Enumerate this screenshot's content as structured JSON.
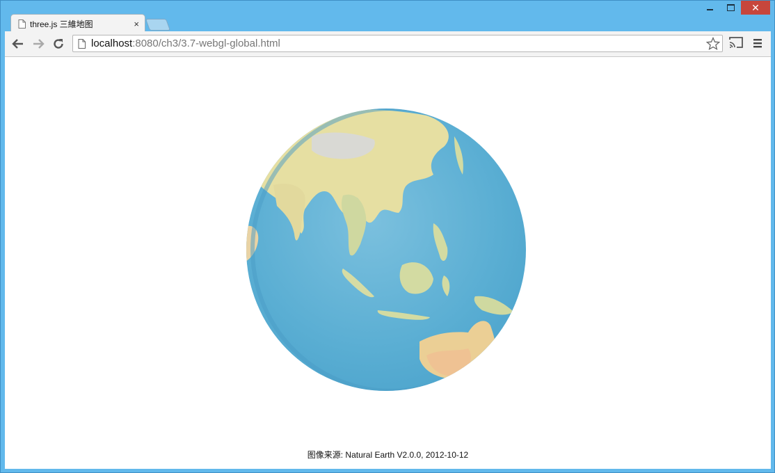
{
  "window": {
    "caption_buttons": [
      "minimize",
      "maximize",
      "close"
    ],
    "close_glyph": "✕"
  },
  "tabs": [
    {
      "title": "three.js 三維地图",
      "close_glyph": "×",
      "icon": "page-icon"
    }
  ],
  "toolbar": {
    "url_host": "localhost",
    "url_rest": ":8080/ch3/3.7-webgl-global.html",
    "icons": [
      "back-icon",
      "forward-icon",
      "reload-icon",
      "star-icon",
      "cast-icon",
      "menu-icon"
    ]
  },
  "content": {
    "credit": "图像来源: Natural Earth V2.0.0, 2012-10-12"
  },
  "colors": {
    "titlebar": "#62b9ec",
    "ocean": "#6cb5d6",
    "land": "#e8e2a8",
    "close": "#c7463c"
  }
}
